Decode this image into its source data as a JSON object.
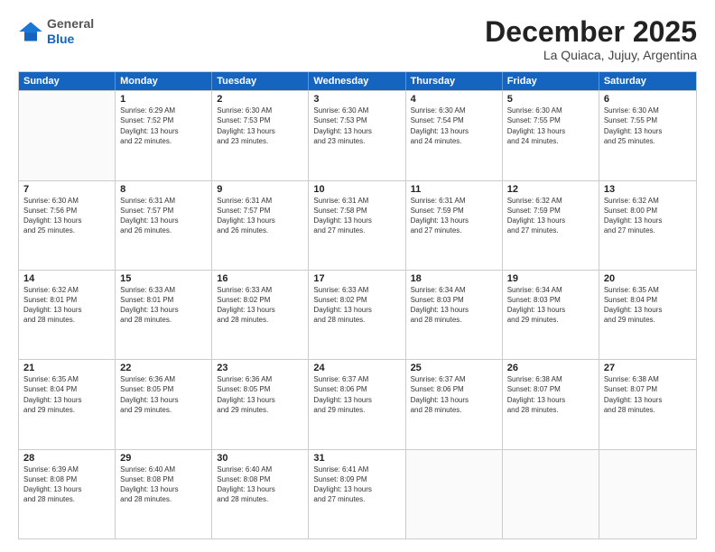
{
  "logo": {
    "general": "General",
    "blue": "Blue"
  },
  "title": "December 2025",
  "location": "La Quiaca, Jujuy, Argentina",
  "days_of_week": [
    "Sunday",
    "Monday",
    "Tuesday",
    "Wednesday",
    "Thursday",
    "Friday",
    "Saturday"
  ],
  "weeks": [
    [
      {
        "day": "",
        "info": ""
      },
      {
        "day": "1",
        "info": "Sunrise: 6:29 AM\nSunset: 7:52 PM\nDaylight: 13 hours\nand 22 minutes."
      },
      {
        "day": "2",
        "info": "Sunrise: 6:30 AM\nSunset: 7:53 PM\nDaylight: 13 hours\nand 23 minutes."
      },
      {
        "day": "3",
        "info": "Sunrise: 6:30 AM\nSunset: 7:53 PM\nDaylight: 13 hours\nand 23 minutes."
      },
      {
        "day": "4",
        "info": "Sunrise: 6:30 AM\nSunset: 7:54 PM\nDaylight: 13 hours\nand 24 minutes."
      },
      {
        "day": "5",
        "info": "Sunrise: 6:30 AM\nSunset: 7:55 PM\nDaylight: 13 hours\nand 24 minutes."
      },
      {
        "day": "6",
        "info": "Sunrise: 6:30 AM\nSunset: 7:55 PM\nDaylight: 13 hours\nand 25 minutes."
      }
    ],
    [
      {
        "day": "7",
        "info": "Sunrise: 6:30 AM\nSunset: 7:56 PM\nDaylight: 13 hours\nand 25 minutes."
      },
      {
        "day": "8",
        "info": "Sunrise: 6:31 AM\nSunset: 7:57 PM\nDaylight: 13 hours\nand 26 minutes."
      },
      {
        "day": "9",
        "info": "Sunrise: 6:31 AM\nSunset: 7:57 PM\nDaylight: 13 hours\nand 26 minutes."
      },
      {
        "day": "10",
        "info": "Sunrise: 6:31 AM\nSunset: 7:58 PM\nDaylight: 13 hours\nand 27 minutes."
      },
      {
        "day": "11",
        "info": "Sunrise: 6:31 AM\nSunset: 7:59 PM\nDaylight: 13 hours\nand 27 minutes."
      },
      {
        "day": "12",
        "info": "Sunrise: 6:32 AM\nSunset: 7:59 PM\nDaylight: 13 hours\nand 27 minutes."
      },
      {
        "day": "13",
        "info": "Sunrise: 6:32 AM\nSunset: 8:00 PM\nDaylight: 13 hours\nand 27 minutes."
      }
    ],
    [
      {
        "day": "14",
        "info": "Sunrise: 6:32 AM\nSunset: 8:01 PM\nDaylight: 13 hours\nand 28 minutes."
      },
      {
        "day": "15",
        "info": "Sunrise: 6:33 AM\nSunset: 8:01 PM\nDaylight: 13 hours\nand 28 minutes."
      },
      {
        "day": "16",
        "info": "Sunrise: 6:33 AM\nSunset: 8:02 PM\nDaylight: 13 hours\nand 28 minutes."
      },
      {
        "day": "17",
        "info": "Sunrise: 6:33 AM\nSunset: 8:02 PM\nDaylight: 13 hours\nand 28 minutes."
      },
      {
        "day": "18",
        "info": "Sunrise: 6:34 AM\nSunset: 8:03 PM\nDaylight: 13 hours\nand 28 minutes."
      },
      {
        "day": "19",
        "info": "Sunrise: 6:34 AM\nSunset: 8:03 PM\nDaylight: 13 hours\nand 29 minutes."
      },
      {
        "day": "20",
        "info": "Sunrise: 6:35 AM\nSunset: 8:04 PM\nDaylight: 13 hours\nand 29 minutes."
      }
    ],
    [
      {
        "day": "21",
        "info": "Sunrise: 6:35 AM\nSunset: 8:04 PM\nDaylight: 13 hours\nand 29 minutes."
      },
      {
        "day": "22",
        "info": "Sunrise: 6:36 AM\nSunset: 8:05 PM\nDaylight: 13 hours\nand 29 minutes."
      },
      {
        "day": "23",
        "info": "Sunrise: 6:36 AM\nSunset: 8:05 PM\nDaylight: 13 hours\nand 29 minutes."
      },
      {
        "day": "24",
        "info": "Sunrise: 6:37 AM\nSunset: 8:06 PM\nDaylight: 13 hours\nand 29 minutes."
      },
      {
        "day": "25",
        "info": "Sunrise: 6:37 AM\nSunset: 8:06 PM\nDaylight: 13 hours\nand 28 minutes."
      },
      {
        "day": "26",
        "info": "Sunrise: 6:38 AM\nSunset: 8:07 PM\nDaylight: 13 hours\nand 28 minutes."
      },
      {
        "day": "27",
        "info": "Sunrise: 6:38 AM\nSunset: 8:07 PM\nDaylight: 13 hours\nand 28 minutes."
      }
    ],
    [
      {
        "day": "28",
        "info": "Sunrise: 6:39 AM\nSunset: 8:08 PM\nDaylight: 13 hours\nand 28 minutes."
      },
      {
        "day": "29",
        "info": "Sunrise: 6:40 AM\nSunset: 8:08 PM\nDaylight: 13 hours\nand 28 minutes."
      },
      {
        "day": "30",
        "info": "Sunrise: 6:40 AM\nSunset: 8:08 PM\nDaylight: 13 hours\nand 28 minutes."
      },
      {
        "day": "31",
        "info": "Sunrise: 6:41 AM\nSunset: 8:09 PM\nDaylight: 13 hours\nand 27 minutes."
      },
      {
        "day": "",
        "info": ""
      },
      {
        "day": "",
        "info": ""
      },
      {
        "day": "",
        "info": ""
      }
    ]
  ]
}
